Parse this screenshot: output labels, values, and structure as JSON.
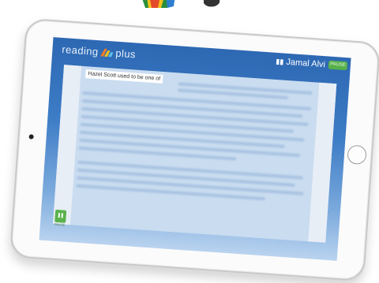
{
  "header": {
    "logo_left": "reading",
    "logo_right": "plus",
    "user_name": "Jamal Alvi",
    "top_button_label": "PAUSE"
  },
  "reader": {
    "highlight_text": "Hazel Scott used to be one of",
    "pause_label": "PAUSE"
  },
  "colors": {
    "screen_blue": "#2d68b3",
    "accent_green": "#56b04a"
  },
  "icons": {
    "logo_mark": "reading-plus-mark-icon",
    "user": "book-icon",
    "pause": "pause-icon"
  }
}
